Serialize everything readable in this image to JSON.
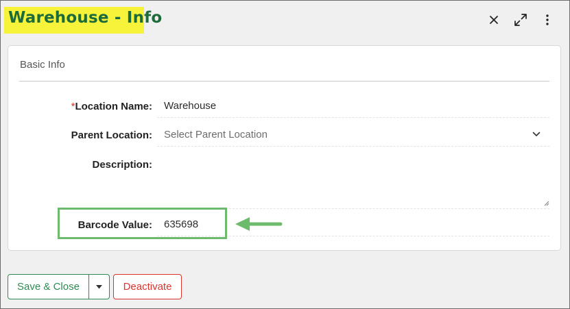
{
  "header": {
    "title": "Warehouse - Info",
    "icons": [
      "close-icon",
      "expand-icon",
      "more-vertical-icon"
    ]
  },
  "card": {
    "section_title": "Basic Info",
    "fields": {
      "location_name": {
        "required_mark": "*",
        "label": "Location Name:",
        "value": "Warehouse"
      },
      "parent_location": {
        "label": "Parent Location:",
        "placeholder": "Select Parent Location",
        "value": ""
      },
      "description": {
        "label": "Description:",
        "value": ""
      },
      "barcode_value": {
        "label": "Barcode Value:",
        "value": "635698"
      }
    }
  },
  "footer": {
    "save_close_label": "Save & Close",
    "deactivate_label": "Deactivate"
  },
  "colors": {
    "title_text": "#1c6b39",
    "title_highlight": "#f6f33a",
    "callout": "#6cbb6c",
    "primary_green": "#2e8a52",
    "danger_red": "#d9342b"
  }
}
